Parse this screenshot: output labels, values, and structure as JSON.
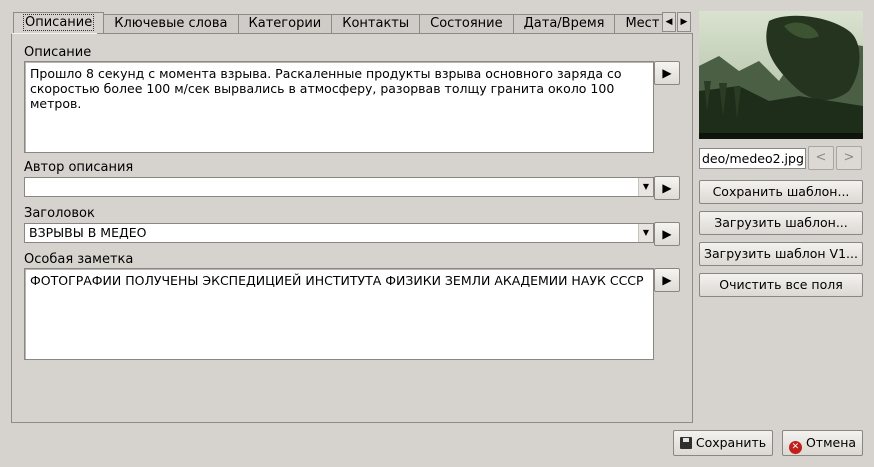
{
  "tabs": [
    {
      "label": "Описание",
      "active": true
    },
    {
      "label": "Ключевые слова",
      "active": false
    },
    {
      "label": "Категории",
      "active": false
    },
    {
      "label": "Контакты",
      "active": false
    },
    {
      "label": "Состояние",
      "active": false
    },
    {
      "label": "Дата/Время",
      "active": false
    },
    {
      "label": "Мест",
      "active": false
    }
  ],
  "icons": {
    "tab_scroll_left": "◀",
    "tab_scroll_right": "▶",
    "play": "▶",
    "combo_arrow": "▼",
    "prev": "<",
    "next": ">",
    "cancel": "✕"
  },
  "fields": {
    "description": {
      "label": "Описание",
      "value": "Прошло 8 секунд с момента взрыва. Раскаленные продукты взрыва основного заряда со скоростью более 100 м/сек вырвались в атмосферу, разорвав толщу гранита около 100 метров."
    },
    "author": {
      "label": "Автор описания",
      "value": ""
    },
    "headline": {
      "label": "Заголовок",
      "value": "ВЗРЫВЫ В МЕДЕО"
    },
    "special_note": {
      "label": "Особая заметка",
      "value": "ФОТОГРАФИИ ПОЛУЧЕНЫ ЭКСПЕДИЦИЕЙ ИНСТИТУТА ФИЗИКИ ЗЕМЛИ АКАДЕМИИ НАУК СССР"
    }
  },
  "preview": {
    "filename": "deo/medeo2.jpg"
  },
  "side_buttons": {
    "save_template": "Сохранить шаблон...",
    "load_template": "Загрузить шаблон...",
    "load_template_v1": "Загрузить шаблон V1...",
    "clear_all": "Очистить все поля"
  },
  "footer": {
    "save": "Сохранить",
    "cancel": "Отмена"
  },
  "colors": {
    "window_bg": "#d6d2cd",
    "field_bg": "#ffffff",
    "cancel_icon": "#c0201c"
  }
}
